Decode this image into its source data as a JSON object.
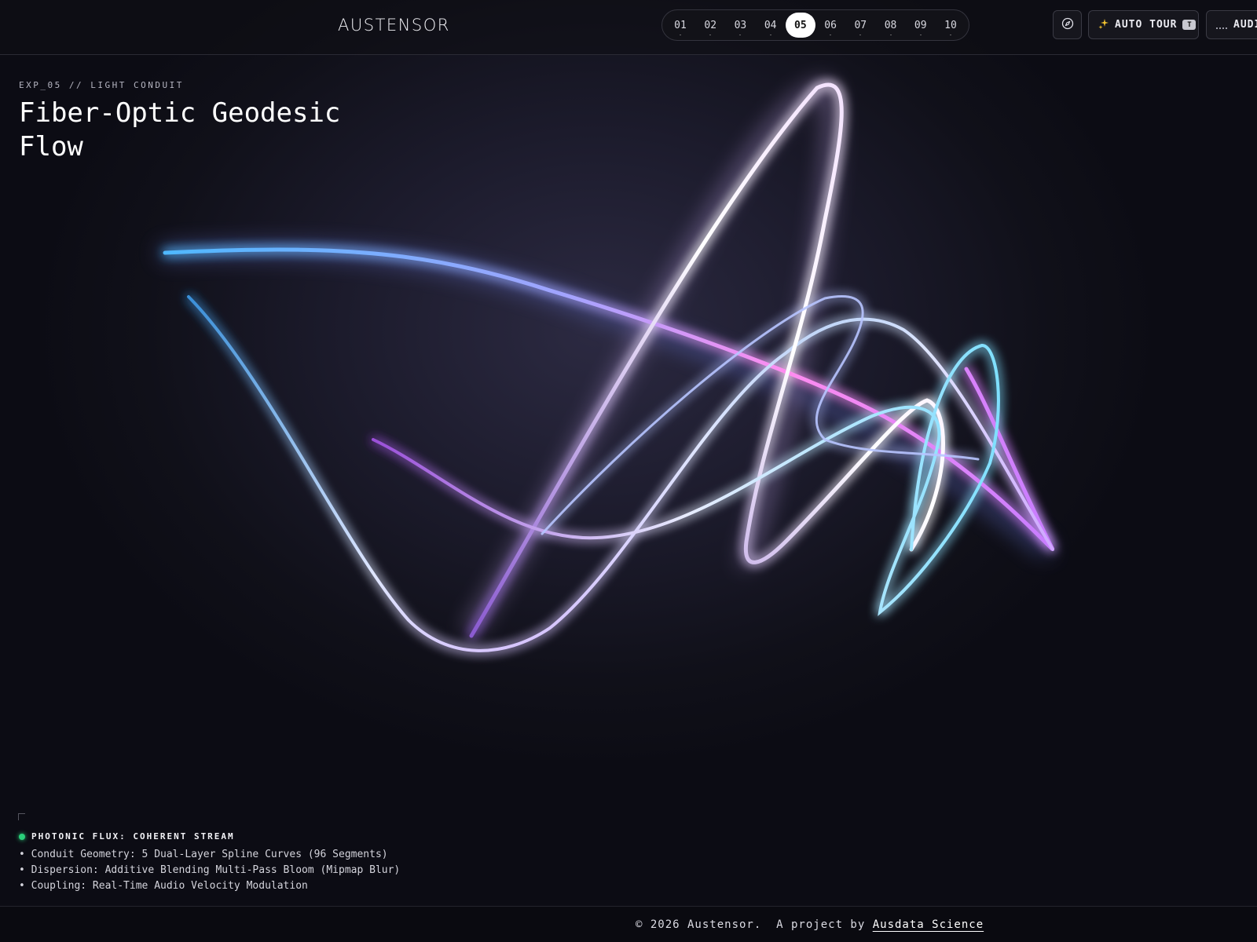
{
  "header": {
    "logo": "AUSTENSOR",
    "steps": [
      "01",
      "02",
      "03",
      "04",
      "05",
      "06",
      "07",
      "08",
      "09",
      "10"
    ],
    "active_step": "05",
    "auto_tour_label": "AUTO TOUR",
    "auto_tour_key": "T",
    "audio_label": "AUDIO"
  },
  "experiment": {
    "eyebrow": "EXP_05 // LIGHT CONDUIT",
    "title": "Fiber-Optic Geodesic Flow"
  },
  "specs": {
    "status": "PHOTONIC FLUX: COHERENT STREAM",
    "items": [
      "Conduit Geometry: 5 Dual-Layer Spline Curves (96 Segments)",
      "Dispersion: Additive Blending Multi-Pass Bloom (Mipmap Blur)",
      "Coupling: Real-Time Audio Velocity Modulation"
    ]
  },
  "footer": {
    "copyright": "© 2026 Austensor.  A project by ",
    "link_label": "Ausdata Science"
  },
  "colors": {
    "accent_cyan": "#6fd4ff",
    "accent_violet": "#c77dff",
    "accent_pink": "#ff8cf0",
    "status_green": "#2ad07a"
  },
  "icons": [
    "compass-icon",
    "sparkle-icon",
    "audio-bars-icon"
  ]
}
